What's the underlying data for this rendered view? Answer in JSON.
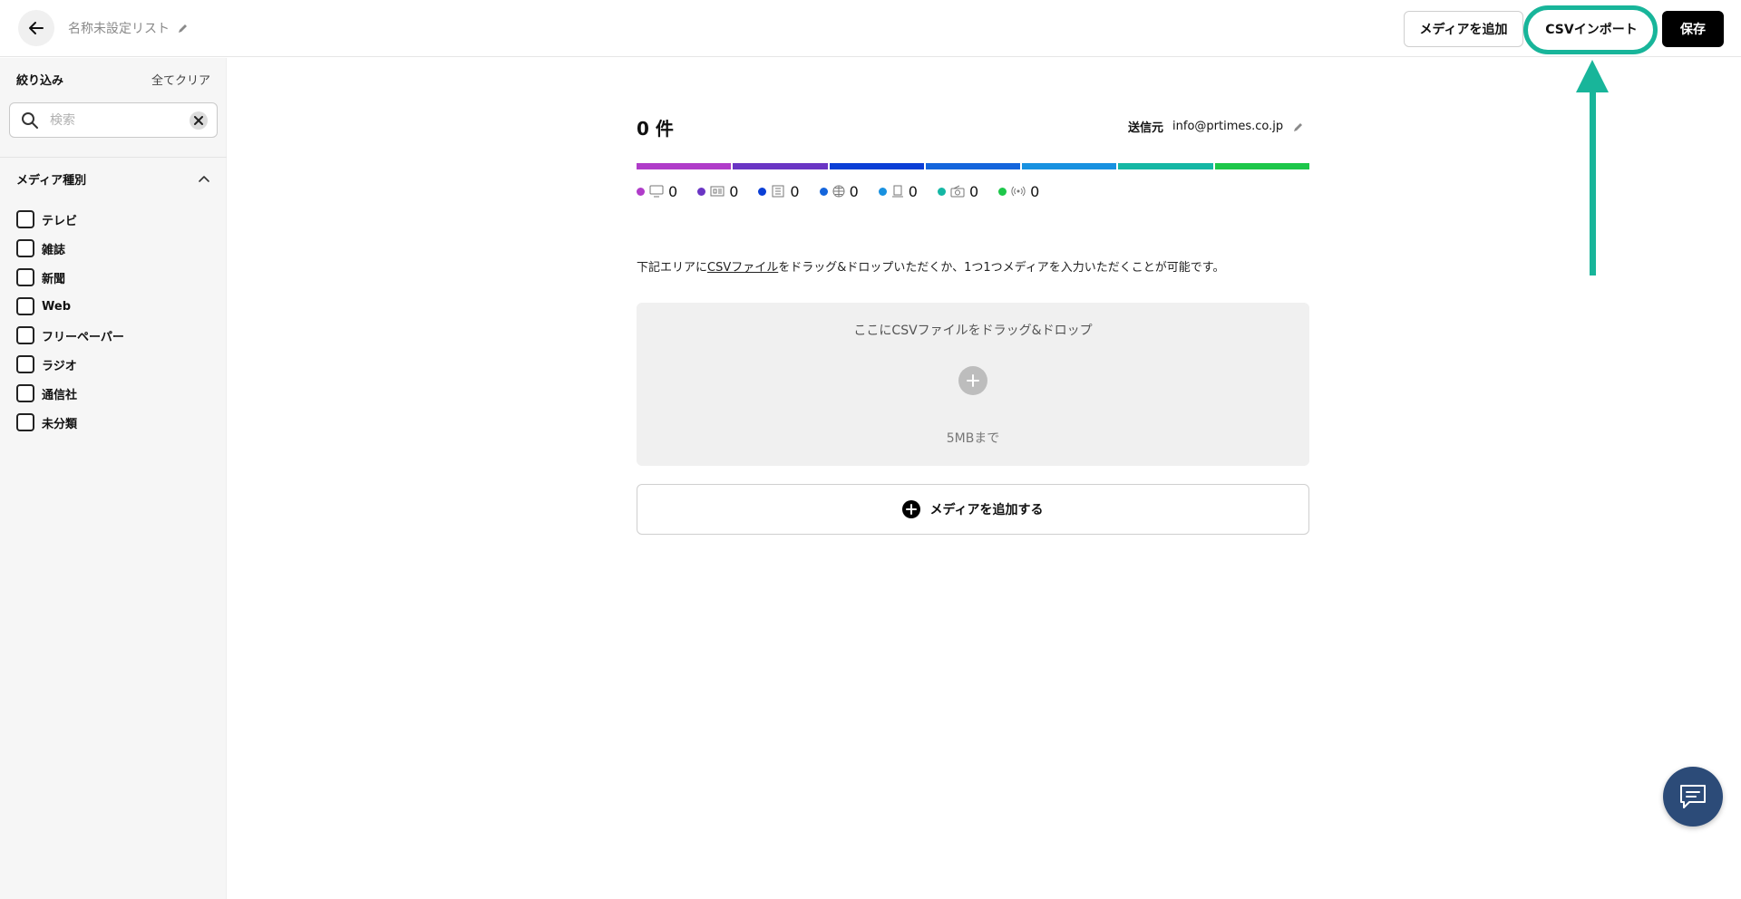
{
  "header": {
    "list_name": "名称未設定リスト",
    "add_media_label": "メディアを追加",
    "csv_import_label": "CSVインポート",
    "save_label": "保存"
  },
  "sidebar": {
    "filter_title": "絞り込み",
    "clear_all": "全てクリア",
    "search_placeholder": "検索",
    "section_title": "メディア種別",
    "categories": [
      "テレビ",
      "雑誌",
      "新聞",
      "Web",
      "フリーペーパー",
      "ラジオ",
      "通信社",
      "未分類"
    ]
  },
  "main": {
    "count_text": "0 件",
    "sender_label": "送信元",
    "sender_email": "info@prtimes.co.jp",
    "bar_colors": [
      "#b03cc9",
      "#6a35c4",
      "#0b3fd6",
      "#1465dc",
      "#1891e0",
      "#15b7a4",
      "#1dc74a"
    ],
    "legend": [
      {
        "color": "#b03cc9",
        "icon": "tv-icon",
        "value": "0"
      },
      {
        "color": "#6a35c4",
        "icon": "magazine-icon",
        "value": "0"
      },
      {
        "color": "#0b3fd6",
        "icon": "newspaper-icon",
        "value": "0"
      },
      {
        "color": "#1465dc",
        "icon": "globe-icon",
        "value": "0"
      },
      {
        "color": "#1891e0",
        "icon": "freepaper-icon",
        "value": "0"
      },
      {
        "color": "#15b7a4",
        "icon": "radio-icon",
        "value": "0"
      },
      {
        "color": "#1dc74a",
        "icon": "broadcast-icon",
        "value": "0"
      }
    ],
    "intro_before": "下記エリアに",
    "intro_link": "CSVファイル",
    "intro_after": "をドラッグ&ドロップいただくか、1つ1つメディアを入力いただくことが可能です。",
    "drop_text": "ここにCSVファイルをドラッグ&ドロップ",
    "drop_limit": "5MBまで",
    "add_media_button": "メディアを追加する"
  },
  "accent_color": "#18b59a"
}
